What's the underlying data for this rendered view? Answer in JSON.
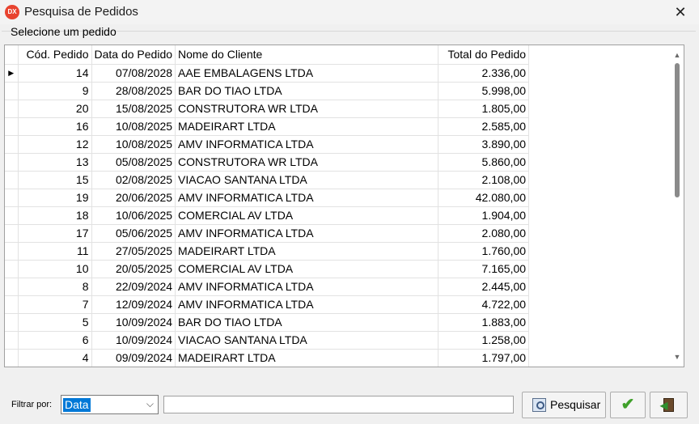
{
  "window": {
    "icon_text": "DX",
    "title": "Pesquisa de Pedidos",
    "close_glyph": "✕"
  },
  "group": {
    "label": "Selecione um pedido"
  },
  "grid": {
    "current_row_glyph": "▶",
    "columns": {
      "cod": "Cód. Pedido",
      "data": "Data do Pedido",
      "nome": "Nome do Cliente",
      "total": "Total do Pedido"
    },
    "rows": [
      {
        "cod": "14",
        "data": "07/08/2028",
        "nome": "AAE EMBALAGENS LTDA",
        "total": "2.336,00"
      },
      {
        "cod": "9",
        "data": "28/08/2025",
        "nome": "BAR DO TIAO LTDA",
        "total": "5.998,00"
      },
      {
        "cod": "20",
        "data": "15/08/2025",
        "nome": "CONSTRUTORA WR LTDA",
        "total": "1.805,00"
      },
      {
        "cod": "16",
        "data": "10/08/2025",
        "nome": "MADEIRART LTDA",
        "total": "2.585,00"
      },
      {
        "cod": "12",
        "data": "10/08/2025",
        "nome": "AMV INFORMATICA LTDA",
        "total": "3.890,00"
      },
      {
        "cod": "13",
        "data": "05/08/2025",
        "nome": "CONSTRUTORA WR LTDA",
        "total": "5.860,00"
      },
      {
        "cod": "15",
        "data": "02/08/2025",
        "nome": "VIACAO SANTANA LTDA",
        "total": "2.108,00"
      },
      {
        "cod": "19",
        "data": "20/06/2025",
        "nome": "AMV INFORMATICA LTDA",
        "total": "42.080,00"
      },
      {
        "cod": "18",
        "data": "10/06/2025",
        "nome": "COMERCIAL AV LTDA",
        "total": "1.904,00"
      },
      {
        "cod": "17",
        "data": "05/06/2025",
        "nome": "AMV INFORMATICA LTDA",
        "total": "2.080,00"
      },
      {
        "cod": "11",
        "data": "27/05/2025",
        "nome": "MADEIRART LTDA",
        "total": "1.760,00"
      },
      {
        "cod": "10",
        "data": "20/05/2025",
        "nome": "COMERCIAL AV LTDA",
        "total": "7.165,00"
      },
      {
        "cod": "8",
        "data": "22/09/2024",
        "nome": "AMV INFORMATICA LTDA",
        "total": "2.445,00"
      },
      {
        "cod": "7",
        "data": "12/09/2024",
        "nome": "AMV INFORMATICA LTDA",
        "total": "4.722,00"
      },
      {
        "cod": "5",
        "data": "10/09/2024",
        "nome": "BAR DO TIAO LTDA",
        "total": "1.883,00"
      },
      {
        "cod": "6",
        "data": "10/09/2024",
        "nome": "VIACAO SANTANA LTDA",
        "total": "1.258,00"
      },
      {
        "cod": "4",
        "data": "09/09/2024",
        "nome": "MADEIRART LTDA",
        "total": "1.797,00"
      }
    ],
    "scroll_up_glyph": "▲",
    "scroll_down_glyph": "▼"
  },
  "filter": {
    "label": "Filtrar por:",
    "selected": "Data",
    "chevron": "⌵",
    "text_value": ""
  },
  "buttons": {
    "search_label": "Pesquisar",
    "ok_glyph": "✔",
    "exit_glyph": "◀"
  },
  "colors": {
    "selection": "#0078d7",
    "ok_check": "#3fa02a",
    "app_icon": "#e8432f"
  }
}
